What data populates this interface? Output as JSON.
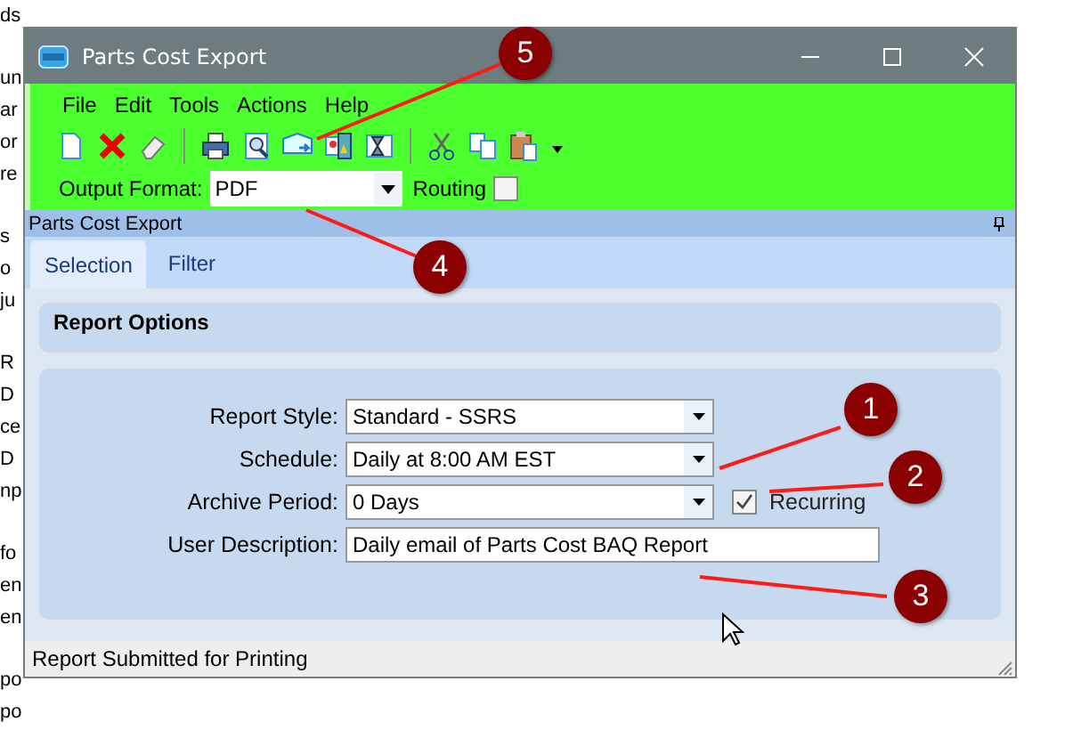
{
  "background_fragments": [
    [
      "ds"
    ],
    [
      "un",
      "ar",
      "or",
      "re"
    ],
    [
      "s",
      "o",
      "ju"
    ],
    [
      "R",
      "D",
      "ce",
      "D",
      "np"
    ],
    [
      "fo",
      "en",
      "en"
    ],
    [
      "po",
      "po"
    ]
  ],
  "window": {
    "title": "Parts Cost Export"
  },
  "menu": [
    "File",
    "Edit",
    "Tools",
    "Actions",
    "Help"
  ],
  "toolbar": [
    {
      "kind": "new"
    },
    {
      "kind": "delete"
    },
    {
      "kind": "eraser"
    },
    {
      "kind": "separator"
    },
    {
      "kind": "print"
    },
    {
      "kind": "preview"
    },
    {
      "kind": "email"
    },
    {
      "kind": "attach"
    },
    {
      "kind": "schedule"
    },
    {
      "kind": "separator"
    },
    {
      "kind": "cut"
    },
    {
      "kind": "copy"
    },
    {
      "kind": "paste"
    },
    {
      "kind": "caret"
    }
  ],
  "output_format": {
    "label": "Output Format:",
    "value": "PDF"
  },
  "routing": {
    "label": "Routing",
    "checked": false
  },
  "panel_title": "Parts Cost Export",
  "tabs": [
    {
      "label": "Selection",
      "selected": true
    },
    {
      "label": "Filter",
      "selected": false
    }
  ],
  "report_options": {
    "title": "Report Options"
  },
  "fields": [
    {
      "kind": "dropdown",
      "label": "Report Style:",
      "value": "Standard - SSRS"
    },
    {
      "kind": "dropdown",
      "label": "Schedule:",
      "value": "Daily at 8:00 AM EST"
    },
    {
      "kind": "dropdown",
      "label": "Archive Period:",
      "value": "0 Days",
      "checkbox": {
        "label": "Recurring",
        "checked": true
      }
    },
    {
      "kind": "text",
      "label": "User Description:",
      "value": "Daily email of Parts Cost BAQ Report"
    }
  ],
  "status_bar": "Report Submitted for Printing",
  "callouts": [
    {
      "number": "1"
    },
    {
      "number": "2"
    },
    {
      "number": "3"
    },
    {
      "number": "4"
    },
    {
      "number": "5"
    }
  ]
}
